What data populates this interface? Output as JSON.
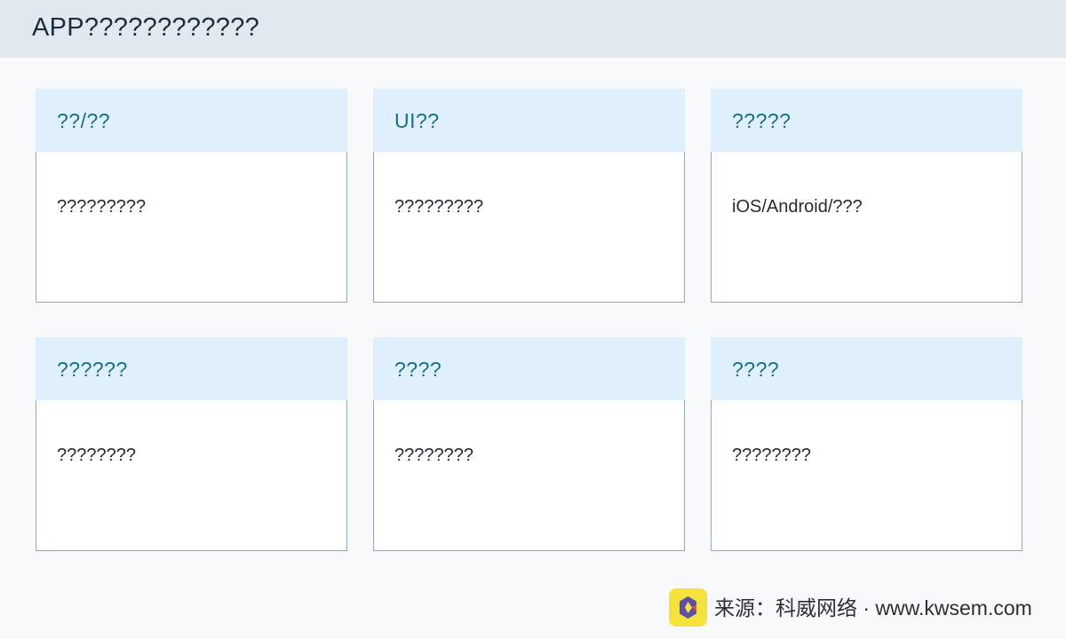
{
  "header": {
    "title": "APP????????????"
  },
  "cards": [
    {
      "title": "??/??",
      "text": "?????????"
    },
    {
      "title": "UI??",
      "text": "?????????"
    },
    {
      "title": "?????",
      "text": "iOS/Android/???"
    },
    {
      "title": "??????",
      "text": "????????"
    },
    {
      "title": "????",
      "text": "????????"
    },
    {
      "title": "????",
      "text": "????????"
    }
  ],
  "footer": {
    "logo_icon": "kwsem-logo-icon",
    "source_text": "来源：科威网络 · www.kwsem.com"
  },
  "colors": {
    "header_bg": "#e1e8f0",
    "card_header_bg": "#dff0fc",
    "card_title": "#1a6f87",
    "logo_bg": "#f5e33b",
    "logo_accent": "#5b4fa8"
  }
}
